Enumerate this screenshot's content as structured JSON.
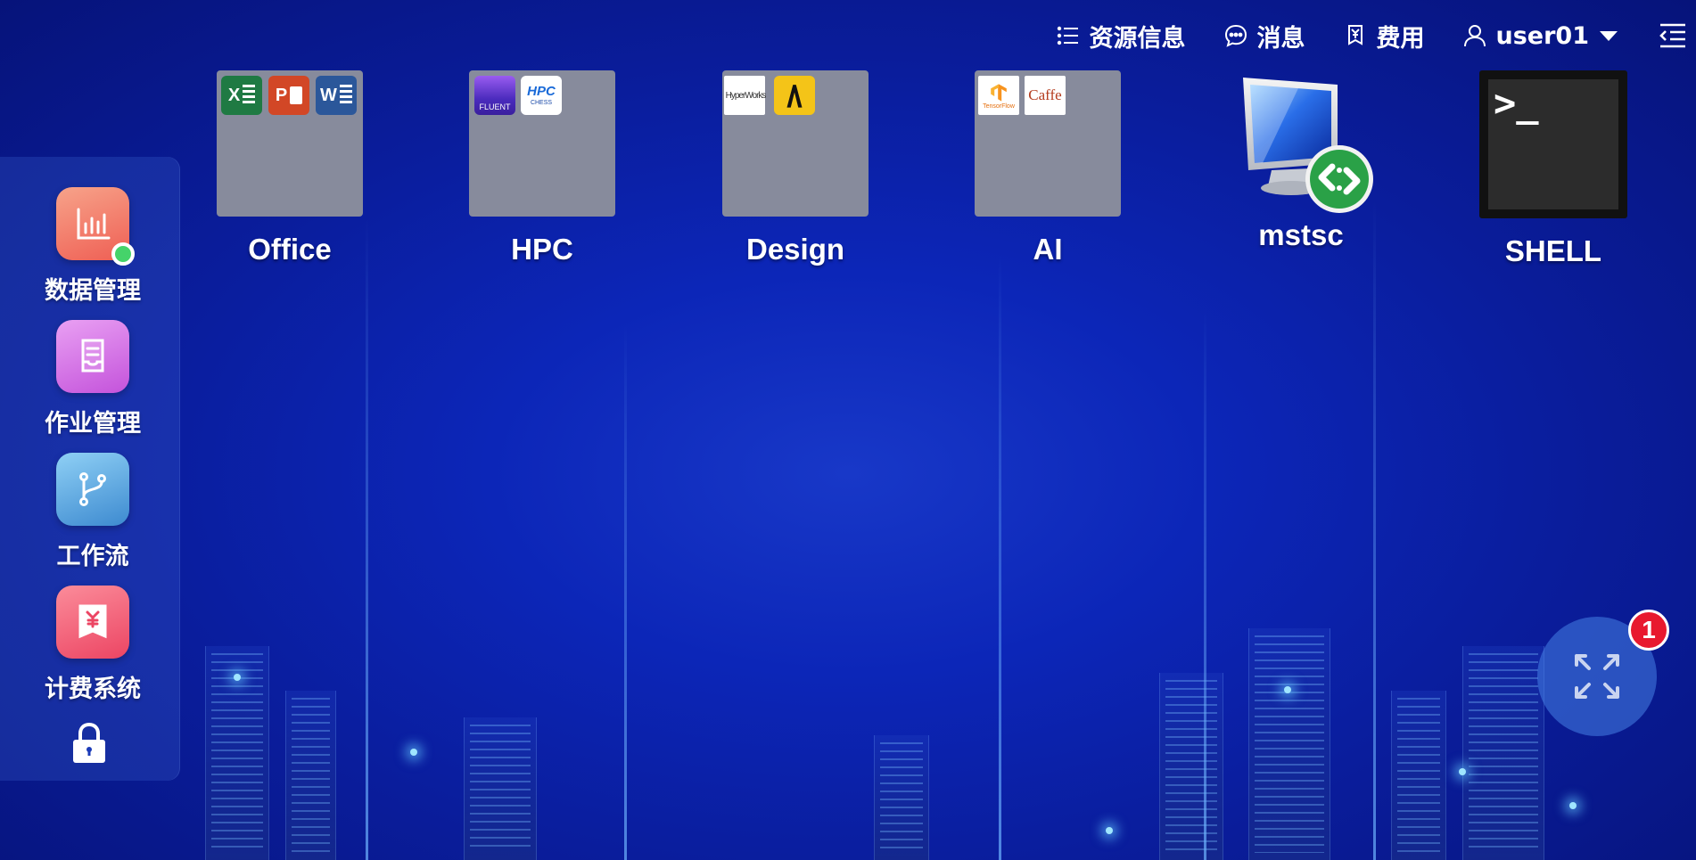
{
  "topbar": {
    "resource_info": "资源信息",
    "messages": "消息",
    "billing": "费用",
    "username": "user01"
  },
  "dock": {
    "items": [
      {
        "label": "数据管理",
        "icon": "bar-chart-icon",
        "color": "#f17663"
      },
      {
        "label": "作业管理",
        "icon": "document-tray-icon",
        "color": "#d060e0"
      },
      {
        "label": "工作流",
        "icon": "branch-icon",
        "color": "#4a98d6"
      },
      {
        "label": "计费系统",
        "icon": "yen-receipt-icon",
        "color": "#f0506a"
      }
    ]
  },
  "apps": [
    {
      "label": "Office",
      "sub_icons": [
        "excel-icon",
        "powerpoint-icon",
        "word-icon"
      ]
    },
    {
      "label": "HPC",
      "sub_icons": [
        "fluent-icon",
        "hpc-chess-icon"
      ],
      "fluent_text": "FLUENT",
      "hpc_text": "HPC",
      "chess_text": "CHESS"
    },
    {
      "label": "Design",
      "sub_icons": [
        "hyperworks-icon",
        "adams-icon"
      ],
      "hyperworks_text": "HyperWorks"
    },
    {
      "label": "AI",
      "sub_icons": [
        "tensorflow-icon",
        "caffe-icon"
      ],
      "tensorflow_text": "TensorFlow",
      "caffe_text": "Caffe"
    },
    {
      "label": "mstsc",
      "icon": "remote-desktop-icon"
    },
    {
      "label": "SHELL",
      "icon": "terminal-icon",
      "prompt": ">_"
    }
  ],
  "notifications": {
    "count": "1"
  },
  "colors": {
    "background": "#0a1d9c",
    "tile": "#878b9c",
    "badge": "#e8192e",
    "online": "#45d36a"
  }
}
